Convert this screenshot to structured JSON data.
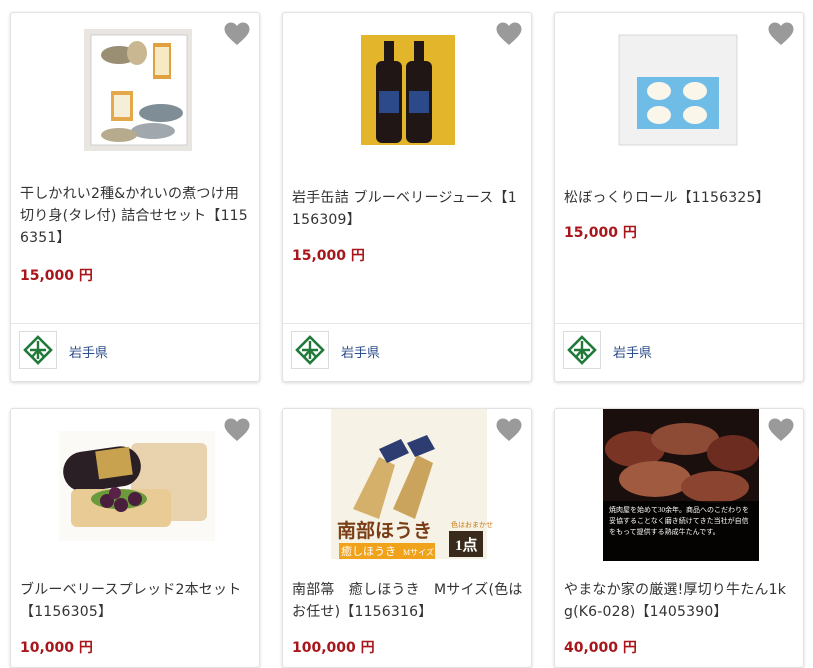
{
  "heart_icon": "heart-icon",
  "colors": {
    "price": "#a8151a",
    "prefecture_link": "#2b4d8c",
    "emblem_green": "#1f7a3a",
    "heart": "#9a9a9a"
  },
  "products": [
    {
      "title": "干しかれい2種&かれいの煮つけ用切り身(タレ付) 詰合せセット【1156351】",
      "price": "15,000 円",
      "prefecture": "岩手県"
    },
    {
      "title": "岩手缶詰 ブルーベリージュース【1156309】",
      "price": "15,000 円",
      "prefecture": "岩手県"
    },
    {
      "title": "松ぼっくりロール【1156325】",
      "price": "15,000 円",
      "prefecture": "岩手県"
    },
    {
      "title": "ブルーベリースプレッド2本セット【1156305】",
      "price": "10,000 円"
    },
    {
      "title": "南部箒　癒しほうき　Mサイズ(色はお任せ)【1156316】",
      "price": "100,000 円",
      "image_text": {
        "brand": "南部ほうき",
        "sub": "癒しほうき",
        "size": "Mサイズ",
        "note": "色はおまかせ",
        "count": "1点"
      }
    },
    {
      "title": "やまなか家の厳選!厚切り牛たん1kg(K6-028)【1405390】",
      "price": "40,000 円",
      "image_text": {
        "caption": "焼肉屋を始めて30余年。商品へのこだわりを妥協することなく磨き続けてきた当社が自信をもって提供する熟成牛たんです。"
      }
    }
  ]
}
